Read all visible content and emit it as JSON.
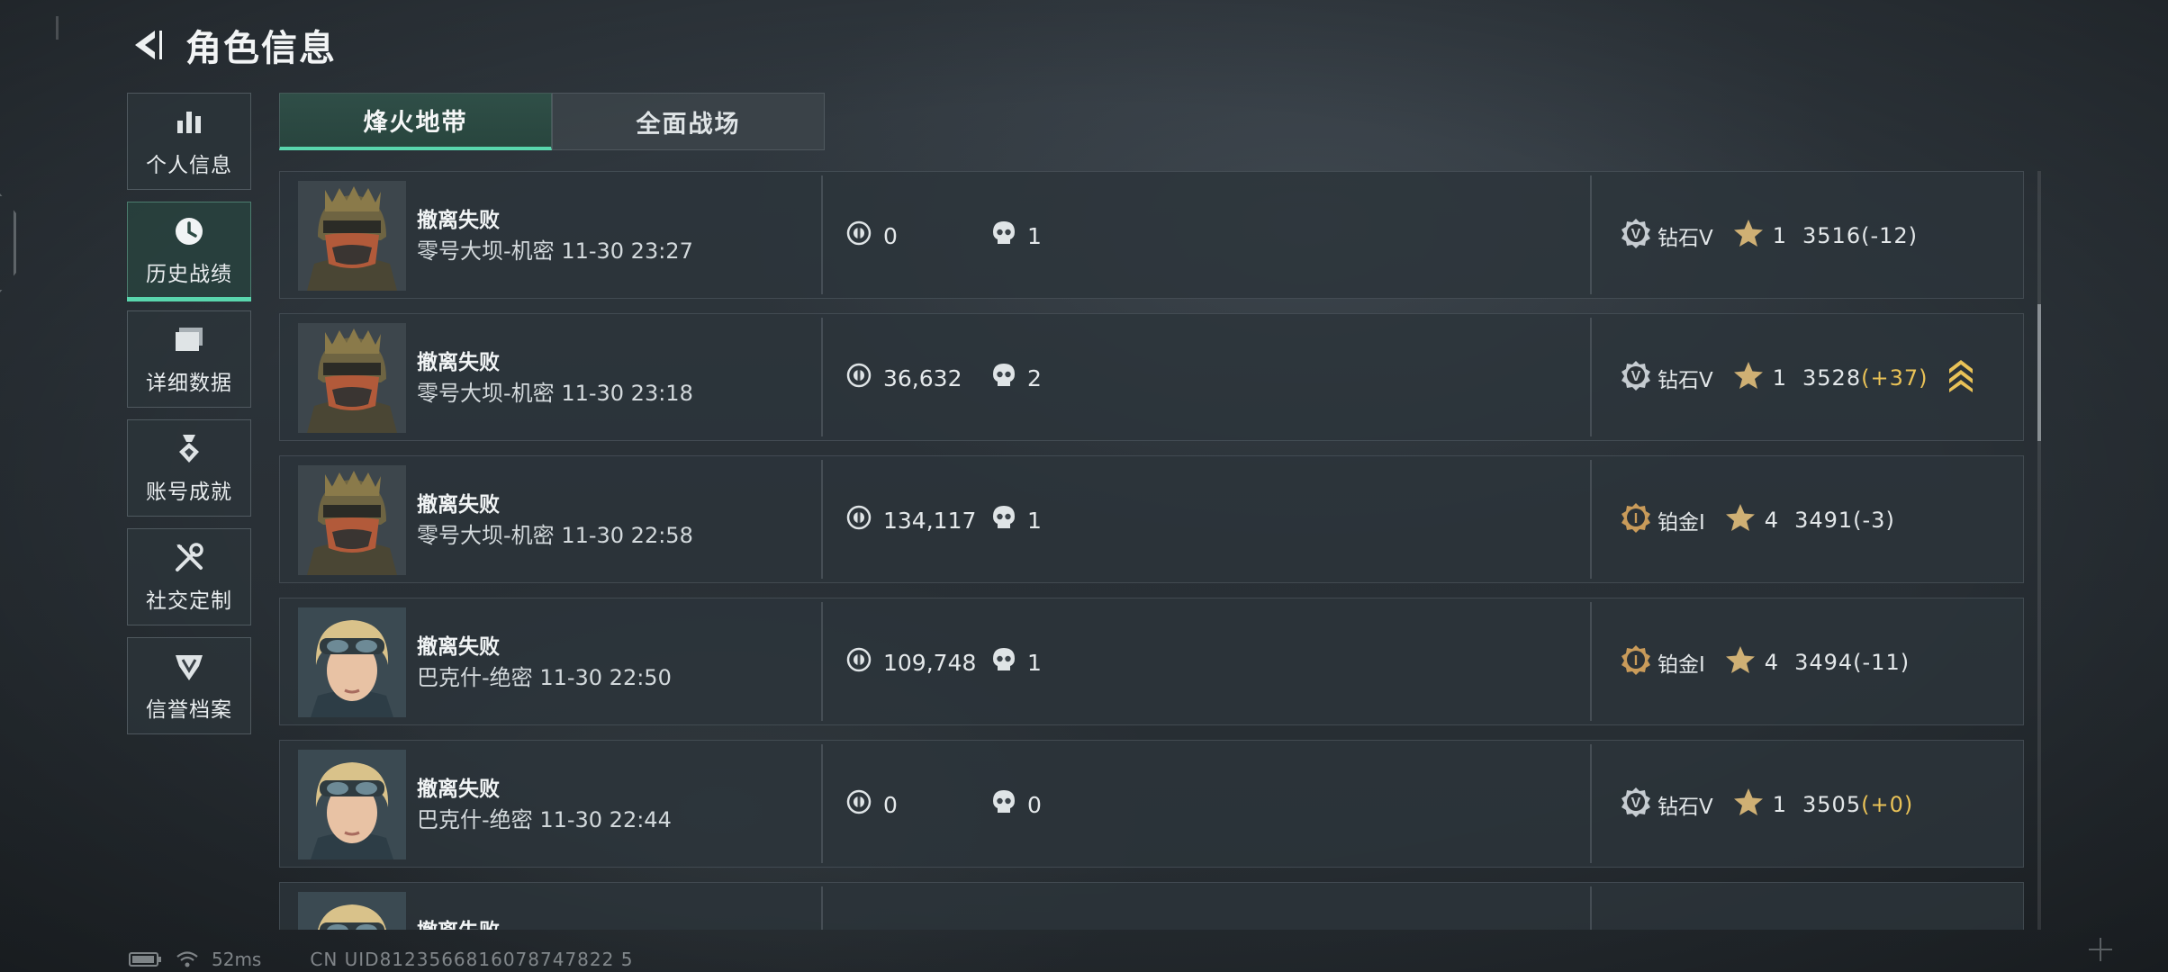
{
  "header": {
    "title": "角色信息"
  },
  "sidebar": {
    "items": [
      {
        "label": "个人信息",
        "icon": "bar-chart-icon",
        "active": false
      },
      {
        "label": "历史战绩",
        "icon": "clock-icon",
        "active": true
      },
      {
        "label": "详细数据",
        "icon": "folder-icon",
        "active": false
      },
      {
        "label": "账号成就",
        "icon": "medal-icon",
        "active": false
      },
      {
        "label": "社交定制",
        "icon": "tools-icon",
        "active": false
      },
      {
        "label": "信誉档案",
        "icon": "shield-icon",
        "active": false
      }
    ]
  },
  "tabs": [
    {
      "label": "烽火地带",
      "active": true
    },
    {
      "label": "全面战场",
      "active": false
    }
  ],
  "matches": [
    {
      "result": "撤离失败",
      "map": "零号大坝-机密",
      "time": "11-30 23:27",
      "value": "0",
      "kills": "1",
      "rank_icon": "diamond-rank-icon",
      "rank": "钻石V",
      "stars": "1",
      "score": "3516",
      "delta": "(-12)",
      "delta_positive": false,
      "avatar": "soldier-helmet",
      "rank_up": false
    },
    {
      "result": "撤离失败",
      "map": "零号大坝-机密",
      "time": "11-30 23:18",
      "value": "36,632",
      "kills": "2",
      "rank_icon": "diamond-rank-icon",
      "rank": "钻石V",
      "stars": "1",
      "score": "3528",
      "delta": "(+37)",
      "delta_positive": true,
      "avatar": "soldier-helmet",
      "rank_up": true
    },
    {
      "result": "撤离失败",
      "map": "零号大坝-机密",
      "time": "11-30 22:58",
      "value": "134,117",
      "kills": "1",
      "rank_icon": "platinum-rank-icon",
      "rank": "铂金I",
      "stars": "4",
      "score": "3491",
      "delta": "(-3)",
      "delta_positive": false,
      "avatar": "soldier-helmet",
      "rank_up": false
    },
    {
      "result": "撤离失败",
      "map": "巴克什-绝密",
      "time": "11-30 22:50",
      "value": "109,748",
      "kills": "1",
      "rank_icon": "platinum-rank-icon",
      "rank": "铂金I",
      "stars": "4",
      "score": "3494",
      "delta": "(-11)",
      "delta_positive": false,
      "avatar": "blonde-goggles",
      "rank_up": false
    },
    {
      "result": "撤离失败",
      "map": "巴克什-绝密",
      "time": "11-30 22:44",
      "value": "0",
      "kills": "0",
      "rank_icon": "diamond-rank-icon",
      "rank": "钻石V",
      "stars": "1",
      "score": "3505",
      "delta": "(+0)",
      "delta_positive": true,
      "avatar": "blonde-goggles",
      "rank_up": false
    },
    {
      "result": "撤离失败",
      "map": "",
      "time": "",
      "value": "",
      "kills": "",
      "rank_icon": "diamond-rank-icon",
      "rank": "",
      "stars": "",
      "score": "",
      "delta": "",
      "delta_positive": false,
      "avatar": "blonde-goggles",
      "rank_up": false
    }
  ],
  "footer": {
    "ping": "52ms",
    "uid": "CN UID8123566816078747822 5"
  },
  "colors": {
    "accent": "#59d6ad",
    "gold": "#e9c257",
    "panel": "#2c343a"
  }
}
